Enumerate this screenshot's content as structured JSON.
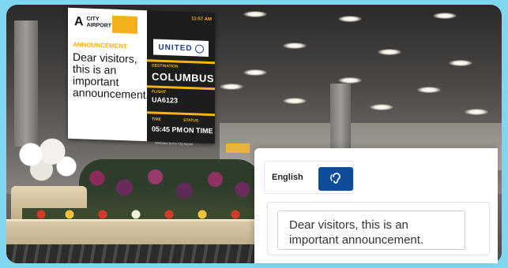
{
  "screen": {
    "logo_mark": "A",
    "logo_text": "CITY AIRPORT",
    "announcement_label": "ANNOUNCEMENT:",
    "announcement_text": "Dear visitors, this is an important announcement.",
    "time": "11:57 AM",
    "airline": "UNITED",
    "destination_label": "DESTINATION",
    "destination": "COLUMBUS",
    "flight_label": "FLIGHT",
    "flight": "UA6123",
    "time_label": "TIME",
    "status_label": "STATUS",
    "departure_time": "05:45 PM",
    "status": "ON TIME",
    "footer": "Welcome to the City Airport"
  },
  "panel": {
    "language": "English",
    "listen_icon": "ear-icon",
    "translated_text": "Dear visitors, this is an important announcement."
  },
  "colors": {
    "accent_yellow": "#f2b21b",
    "button_blue": "#0f4c9c",
    "united_blue": "#1b3f8f",
    "background": "#7fd6ef"
  }
}
